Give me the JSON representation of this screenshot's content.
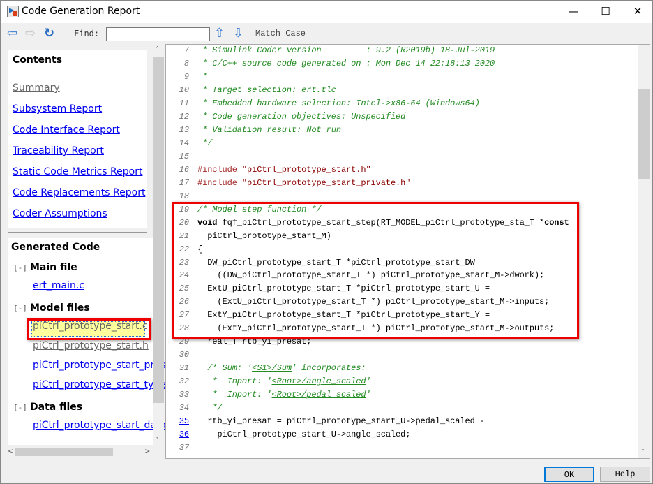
{
  "window": {
    "title": "Code Generation Report",
    "minimize_icon": "minimize-icon",
    "maximize_icon": "maximize-icon",
    "close_icon": "close-icon"
  },
  "toolbar": {
    "find_label": "Find:",
    "find_value": "",
    "match_case": "Match Case"
  },
  "contents": {
    "title": "Contents",
    "links": [
      "Summary",
      "Subsystem Report",
      "Code Interface Report",
      "Traceability Report",
      "Static Code Metrics Report",
      "Code Replacements Report",
      "Coder Assumptions"
    ]
  },
  "generated_code": {
    "title": "Generated Code",
    "toggle": "[-]",
    "groups": [
      {
        "label": "Main file",
        "files": [
          "ert_main.c"
        ]
      },
      {
        "label": "Model files",
        "files": [
          "piCtrl_prototype_start.c",
          "piCtrl_prototype_start.h",
          "piCtrl_prototype_start_private.h",
          "piCtrl_prototype_start_types.h"
        ],
        "selected": "piCtrl_prototype_start.c"
      },
      {
        "label": "Data files",
        "files": [
          "piCtrl_prototype_start_data.c"
        ]
      }
    ]
  },
  "code_lines": [
    {
      "n": "7",
      "s": [
        [
          " * Simulink Coder version         : 9.2 (R2019b) 18-Jul-2019",
          "comment"
        ]
      ]
    },
    {
      "n": "8",
      "s": [
        [
          " * C/C++ source code generated on : Mon Dec 14 22:18:13 2020",
          "comment"
        ]
      ]
    },
    {
      "n": "9",
      "s": [
        [
          " *",
          "comment"
        ]
      ]
    },
    {
      "n": "10",
      "s": [
        [
          " * Target selection: ert.tlc",
          "comment"
        ]
      ]
    },
    {
      "n": "11",
      "s": [
        [
          " * Embedded hardware selection: Intel->x86-64 (Windows64)",
          "comment"
        ]
      ]
    },
    {
      "n": "12",
      "s": [
        [
          " * Code generation objectives: Unspecified",
          "comment"
        ]
      ]
    },
    {
      "n": "13",
      "s": [
        [
          " * Validation result: Not run",
          "comment"
        ]
      ]
    },
    {
      "n": "14",
      "s": [
        [
          " */",
          "comment"
        ]
      ]
    },
    {
      "n": "15",
      "s": []
    },
    {
      "n": "16",
      "s": [
        [
          "#include ",
          "pp"
        ],
        [
          "\"piCtrl_prototype_start.h\"",
          "str"
        ]
      ]
    },
    {
      "n": "17",
      "s": [
        [
          "#include ",
          "pp"
        ],
        [
          "\"piCtrl_prototype_start_private.h\"",
          "str"
        ]
      ]
    },
    {
      "n": "18",
      "s": []
    },
    {
      "n": "19",
      "s": [
        [
          "/* Model step function */",
          "comment"
        ]
      ]
    },
    {
      "n": "20",
      "s": [
        [
          "void",
          "kw"
        ],
        [
          " fqf_piCtrl_prototype_start_step(RT_MODEL_piCtrl_prototype_sta_T *",
          "plain"
        ],
        [
          "const",
          "kw"
        ]
      ]
    },
    {
      "n": "21",
      "s": [
        [
          "  piCtrl_prototype_start_M)",
          "plain"
        ]
      ]
    },
    {
      "n": "22",
      "s": [
        [
          "{",
          "plain"
        ]
      ]
    },
    {
      "n": "23",
      "s": [
        [
          "  DW_piCtrl_prototype_start_T *piCtrl_prototype_start_DW =",
          "plain"
        ]
      ]
    },
    {
      "n": "24",
      "s": [
        [
          "    ((DW_piCtrl_prototype_start_T *) piCtrl_prototype_start_M->dwork);",
          "plain"
        ]
      ]
    },
    {
      "n": "25",
      "s": [
        [
          "  ExtU_piCtrl_prototype_start_T *piCtrl_prototype_start_U =",
          "plain"
        ]
      ]
    },
    {
      "n": "26",
      "s": [
        [
          "    (ExtU_piCtrl_prototype_start_T *) piCtrl_prototype_start_M->inputs;",
          "plain"
        ]
      ]
    },
    {
      "n": "27",
      "s": [
        [
          "  ExtY_piCtrl_prototype_start_T *piCtrl_prototype_start_Y =",
          "plain"
        ]
      ]
    },
    {
      "n": "28",
      "s": [
        [
          "    (ExtY_piCtrl_prototype_start_T *) piCtrl_prototype_start_M->outputs;",
          "plain"
        ]
      ]
    },
    {
      "n": "29",
      "s": [
        [
          "  real_T rtb_yi_presat;",
          "plain"
        ]
      ]
    },
    {
      "n": "30",
      "s": []
    },
    {
      "n": "31",
      "s": [
        [
          "  /* Sum: '",
          "comment"
        ],
        [
          "<S1>/Sum",
          "clink"
        ],
        [
          "' incorporates:",
          "comment"
        ]
      ]
    },
    {
      "n": "32",
      "s": [
        [
          "   *  Inport: '",
          "comment"
        ],
        [
          "<Root>/angle_scaled",
          "clink"
        ],
        [
          "'",
          "comment"
        ]
      ]
    },
    {
      "n": "33",
      "s": [
        [
          "   *  Inport: '",
          "comment"
        ],
        [
          "<Root>/pedal_scaled",
          "clink"
        ],
        [
          "'",
          "comment"
        ]
      ]
    },
    {
      "n": "34",
      "s": [
        [
          "   */",
          "comment"
        ]
      ]
    },
    {
      "n": "35",
      "link": true,
      "s": [
        [
          "  rtb_yi_presat = piCtrl_prototype_start_U->pedal_scaled -",
          "plain"
        ]
      ]
    },
    {
      "n": "36",
      "link": true,
      "s": [
        [
          "    piCtrl_prototype_start_U->angle_scaled;",
          "plain"
        ]
      ]
    },
    {
      "n": "37",
      "s": []
    }
  ],
  "buttons": {
    "ok": "OK",
    "help": "Help"
  },
  "colors": {
    "highlight_box": "#ee0000",
    "selected_file_bg": "#fefe9c",
    "link": "#0000ee",
    "comment": "#228b22"
  }
}
